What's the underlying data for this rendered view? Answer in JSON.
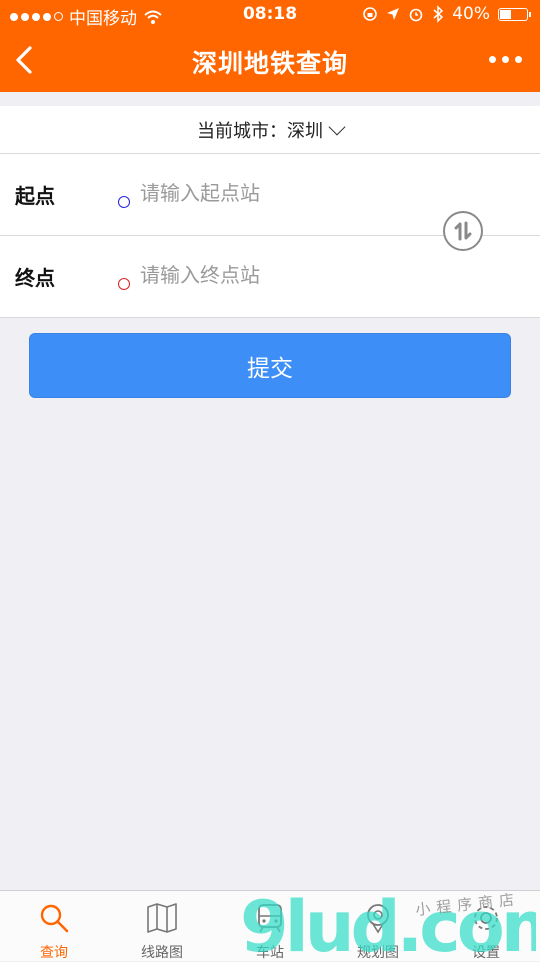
{
  "status_bar": {
    "carrier": "中国移动",
    "time": "08:18",
    "battery": "40%",
    "battery_level": 0.4,
    "icons": [
      "signal-dots",
      "wifi-icon",
      "orientation-lock-icon",
      "location-arrow-icon",
      "alarm-icon",
      "bluetooth-icon",
      "battery-icon"
    ]
  },
  "navbar": {
    "title": "深圳地铁查询",
    "left_icon": "back-chevron-icon",
    "right_icon": "more-dots-icon"
  },
  "city": {
    "label": "当前城市：",
    "value": "深圳",
    "icon": "chevron-down-icon"
  },
  "stations": {
    "start": {
      "label": "起点",
      "placeholder": "请输入起点站",
      "value": "",
      "marker_color": "#2222dd"
    },
    "end": {
      "label": "终点",
      "placeholder": "请输入终点站",
      "value": "",
      "marker_color": "#dd2222"
    },
    "swap_icon": "swap-arrows-icon"
  },
  "submit_label": "提交",
  "colors": {
    "accent": "#ff6600",
    "button": "#3d8ef7",
    "background": "#efeff4"
  },
  "tabs": [
    {
      "label": "查询",
      "icon": "search-icon",
      "active": true
    },
    {
      "label": "线路图",
      "icon": "map-icon",
      "active": false
    },
    {
      "label": "车站",
      "icon": "train-icon",
      "active": false
    },
    {
      "label": "规划图",
      "icon": "location-pin-icon",
      "active": false
    },
    {
      "label": "设置",
      "icon": "gear-icon",
      "active": false
    }
  ],
  "watermark": {
    "text": "9lud.com",
    "sub": "小程序商店"
  }
}
